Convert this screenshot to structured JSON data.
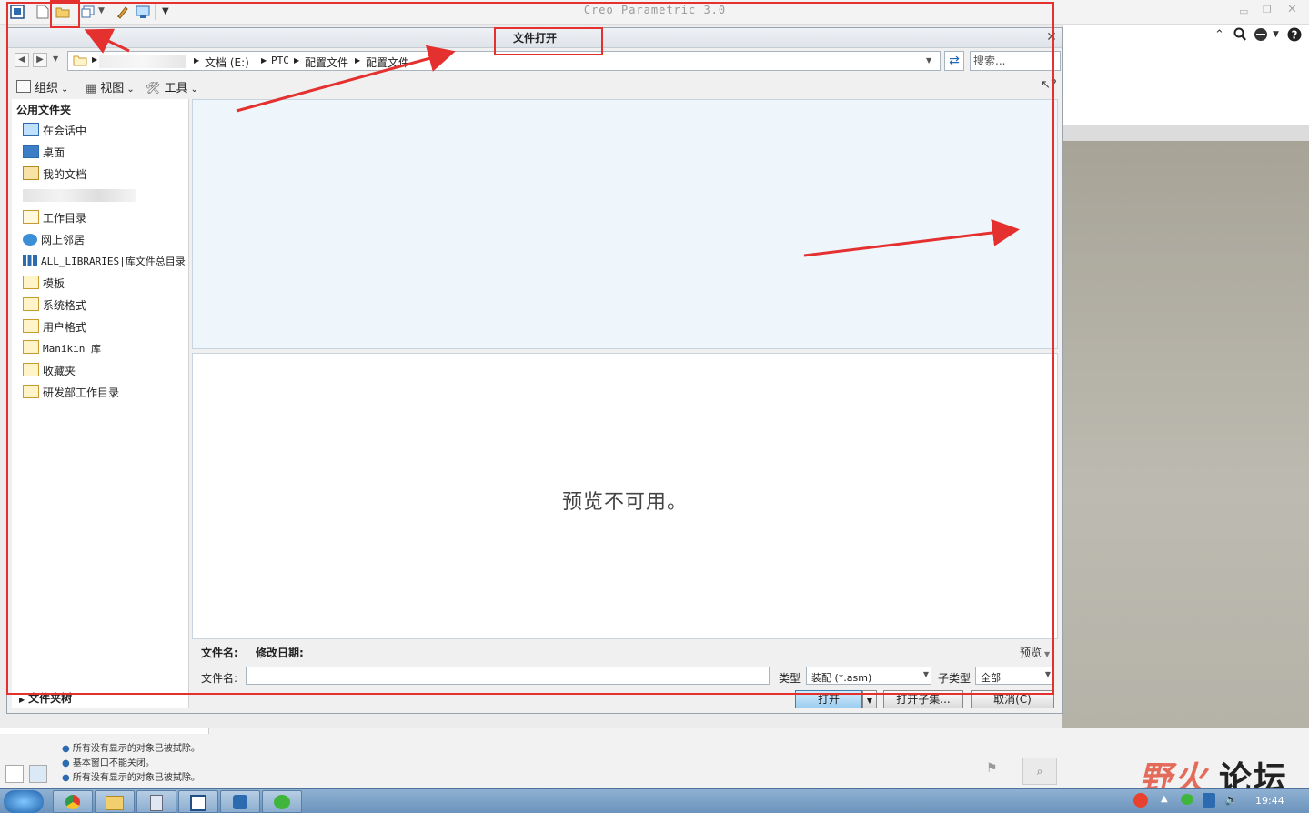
{
  "app": {
    "title": "Creo Parametric 3.0"
  },
  "dialog": {
    "title": "文件打开",
    "breadcrumb": [
      "文档 (E:)",
      "PTC",
      "配置文件",
      "配置文件"
    ],
    "search_placeholder": "搜索...",
    "toolbar": {
      "organize": "组织",
      "view": "视图",
      "tools": "工具"
    },
    "sidebar": {
      "heading": "公用文件夹",
      "items": [
        "在会话中",
        "桌面",
        "我的文档",
        "工作目录",
        "网上邻居",
        "ALL_LIBRARIES|库文件总目录",
        "模板",
        "系统格式",
        "用户格式",
        "Manikin 库",
        "收藏夹",
        "研发部工作目录"
      ],
      "footer": "文件夹树"
    },
    "preview_unavailable": "预览不可用。",
    "meta": {
      "filename_label": "文件名:",
      "modified_label": "修改日期:",
      "preview_label": "预览"
    },
    "filename": {
      "label": "文件名:",
      "value": ""
    },
    "type": {
      "label": "类型",
      "value": "装配 (*.asm)"
    },
    "subtype": {
      "label": "子类型",
      "value": "全部"
    },
    "buttons": {
      "open": "打开",
      "open_subset": "打开子集...",
      "cancel": "取消(C)"
    }
  },
  "messages": [
    "所有没有显示的对象已被拭除。",
    "基本窗口不能关闭。",
    "所有没有显示的对象已被拭除。"
  ],
  "watermark": {
    "part1": "野火",
    "part2": "论坛"
  },
  "taskbar": {
    "clock": "19:44"
  },
  "colors": {
    "annotation_red": "#e53030",
    "dialog_bg": "#f0f0f0",
    "list_bg": "#eef6fb"
  }
}
